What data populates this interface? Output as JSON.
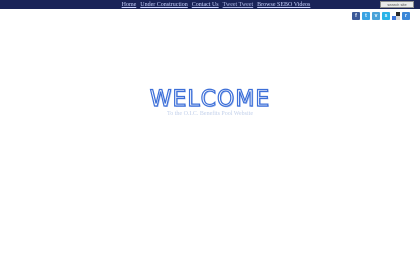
{
  "nav": {
    "links": [
      "Home",
      "Under Construction",
      "Contact Us",
      "Tweet Tweet",
      "Browse SEBO Videos"
    ]
  },
  "search": {
    "placeholder": "search site"
  },
  "social": {
    "icons": [
      {
        "name": "facebook-icon",
        "color": "#3b5998",
        "glyph": "f"
      },
      {
        "name": "twitter-icon",
        "color": "#3aa3e3",
        "glyph": "t"
      },
      {
        "name": "vimeo-icon",
        "color": "#4aa3d9",
        "glyph": "v"
      },
      {
        "name": "skype-icon",
        "color": "#2ab4e8",
        "glyph": "s"
      },
      {
        "name": "delicious-icon",
        "color": "#2a2a2a",
        "glyph": ""
      },
      {
        "name": "rss-icon",
        "color": "#3b87d8",
        "glyph": "r"
      }
    ]
  },
  "hero": {
    "title": "WELCOME",
    "subtitle": "To the O.I.C. Benefits Pool Website"
  },
  "colors": {
    "topbar": "#1a2458",
    "accent": "#3d6fd8"
  }
}
